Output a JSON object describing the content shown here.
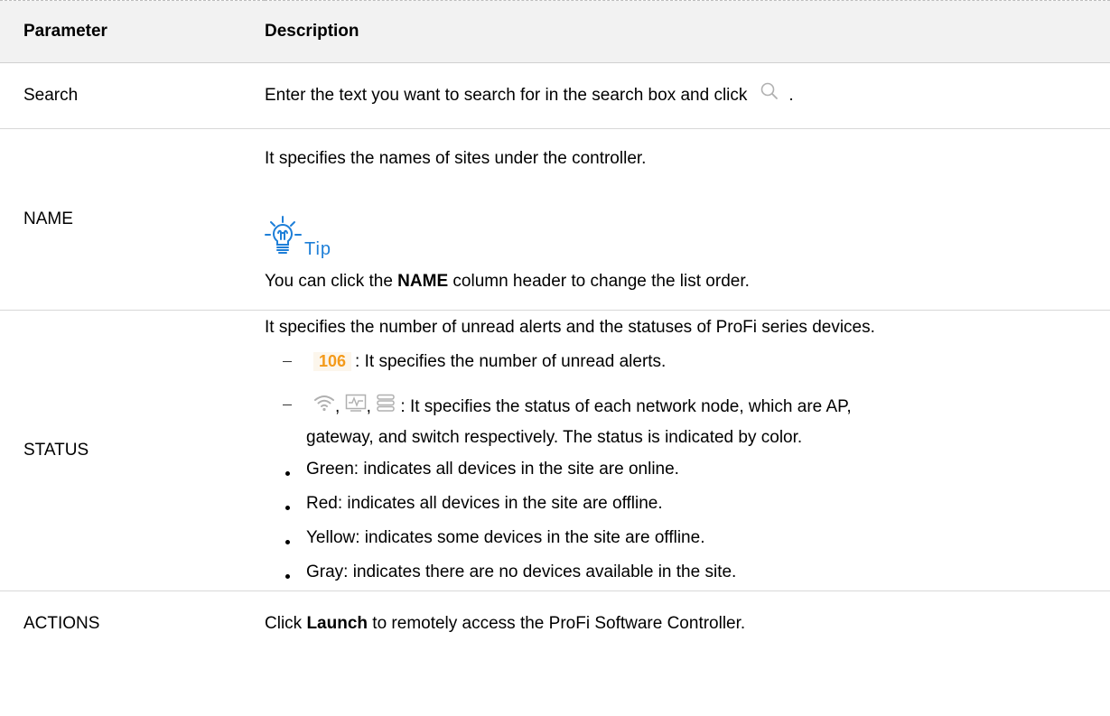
{
  "table": {
    "header": {
      "parameter": "Parameter",
      "description": "Description"
    },
    "search": {
      "param": "Search",
      "desc_before": "Enter the text you want to search for in the search box and click",
      "desc_after": ".",
      "icon": "search-icon"
    },
    "name": {
      "param": "NAME",
      "line1": "It specifies the names of sites under the controller.",
      "tip_label": "Tip",
      "tip_icon": "lightbulb-icon",
      "line3_before": "You can click the ",
      "line3_bold": "NAME",
      "line3_after": " column header to change the list order."
    },
    "status": {
      "param": "STATUS",
      "line1": "It specifies the number of unread alerts and the statuses of ProFi series devices.",
      "alert_badge": "106",
      "alert_badge_color": "#f49a1a",
      "alert_text": ": It specifies the number of unread alerts.",
      "icon_sep1": ",",
      "icon_sep2": ",",
      "node_text_1": ": It specifies the status of each network node, which are AP,",
      "node_text_2": "gateway, and switch respectively. The status is indicated by color.",
      "node_icons": [
        "wifi-icon",
        "gateway-icon",
        "switch-icon"
      ],
      "bullets": [
        "Green: indicates all devices in the site are online.",
        "Red: indicates all devices in the site are offline.",
        "Yellow: indicates some devices in the site are offline.",
        "Gray: indicates there are no devices available in the site."
      ]
    },
    "actions": {
      "param": "ACTIONS",
      "desc_before": "Click ",
      "desc_bold": "Launch",
      "desc_after": " to remotely access the ProFi Software Controller."
    }
  },
  "colors": {
    "header_bg": "#f2f2f2",
    "tip_blue": "#1e7fd8",
    "icon_gray": "#b0b0b0"
  }
}
